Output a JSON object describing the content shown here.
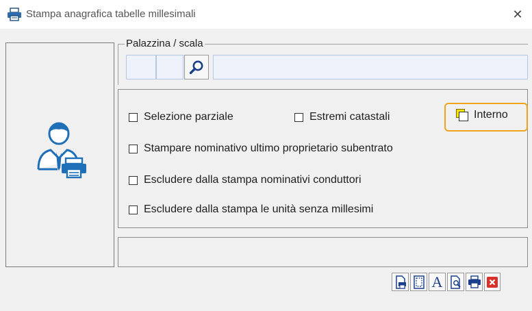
{
  "window": {
    "title": "Stampa anagrafica tabelle millesimali",
    "close_glyph": "✕"
  },
  "palazzina": {
    "legend": "Palazzina / scala",
    "code_a": "",
    "code_b": "",
    "description": ""
  },
  "options": {
    "selezione_parziale": {
      "label": "Selezione parziale",
      "checked": false
    },
    "estremi_catastali": {
      "label": "Estremi catastali",
      "checked": false
    },
    "interno": {
      "label": "Interno",
      "checked": false
    },
    "stampare_nominativo": {
      "label": "Stampare nominativo ultimo proprietario subentrato",
      "checked": false
    },
    "escludere_conduttori": {
      "label": "Escludere dalla stampa nominativi conduttori",
      "checked": false
    },
    "escludere_senza_millesimi": {
      "label": "Escludere dalla stampa le unità senza millesimi",
      "checked": false
    }
  },
  "bottom_field": "",
  "toolbar": {
    "icons": [
      "print-setup-icon",
      "page-layout-icon",
      "font-icon",
      "print-preview-icon",
      "print-icon",
      "close-icon"
    ],
    "close_color": "#d9302c",
    "accent_highlight": "#f2a31c"
  }
}
